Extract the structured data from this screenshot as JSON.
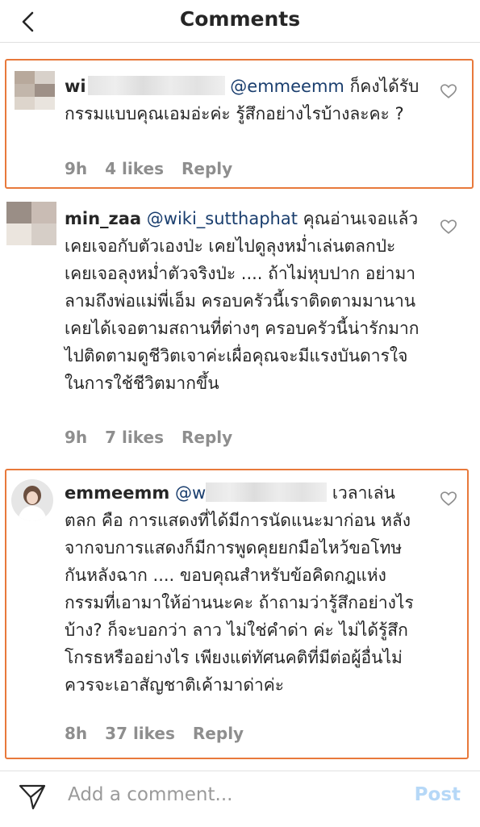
{
  "header": {
    "title": "Comments"
  },
  "comments": [
    {
      "user": "wi",
      "mention": "@emmeemm",
      "text": " ก็คงได้รับกรรมแบบคุณเอมอ่ะค่ะ รู้สึกอย่างไรบ้างละคะ ?",
      "time": "9h",
      "likes": "4 likes",
      "reply": "Reply"
    },
    {
      "user": "min_zaa",
      "mention": "@wiki_sutthaphat",
      "text": " คุณอ่านเจอแล้วเคยเจอกับตัวเองป่ะ เคยไปดูลุงหม่ำเล่นตลกป่ะ เคยเจอลุงหม่ำตัวจริงป่ะ .... ถ้าไม่หุบปาก อย่ามาลามถึงพ่อแม่พี่เอ็ม ครอบครัวนี้เราติดตามมานาน เคยได้เจอตามสถานที่ต่างๆ ครอบครัวนี้น่ารักมาก ไปติดตามดูชีวิตเจาค่ะเผื่อคุณจะมีแรงบันดารใจในการใช้ชีวิตมากขึ้น",
      "time": "9h",
      "likes": "7 likes",
      "reply": "Reply"
    },
    {
      "user": "emmeemm",
      "mention": "@w",
      "text": " เวลาเล่นตลก คือ การแสดงที่ได้มีการนัดแนะมาก่อน หลังจากจบการแสดงก็มีการพูดคุยยกมือไหว้ขอโทษกันหลังฉาก .... ขอบคุณสำหรับข้อคิดกฎแห่งกรรมที่เอามาให้อ่านนะคะ ถ้าถามว่ารู้สึกอย่างไรบ้าง? ก็จะบอกว่า ลาว ไม่ใช่คำด่า ค่ะ ไม่ได้รู้สึกโกรธหรืออย่างไร เพียงแต่ทัศนคติที่มีต่อผู้อื่นไม่ควรจะเอาสัญชาติเค้ามาด่าค่ะ",
      "time": "8h",
      "likes": "37 likes",
      "reply": "Reply"
    }
  ],
  "footer": {
    "placeholder": "Add a comment...",
    "post_label": "Post"
  },
  "colors": {
    "highlight": "#e8793b",
    "mention": "#1a3e6e",
    "post": "#b6d8f7"
  }
}
